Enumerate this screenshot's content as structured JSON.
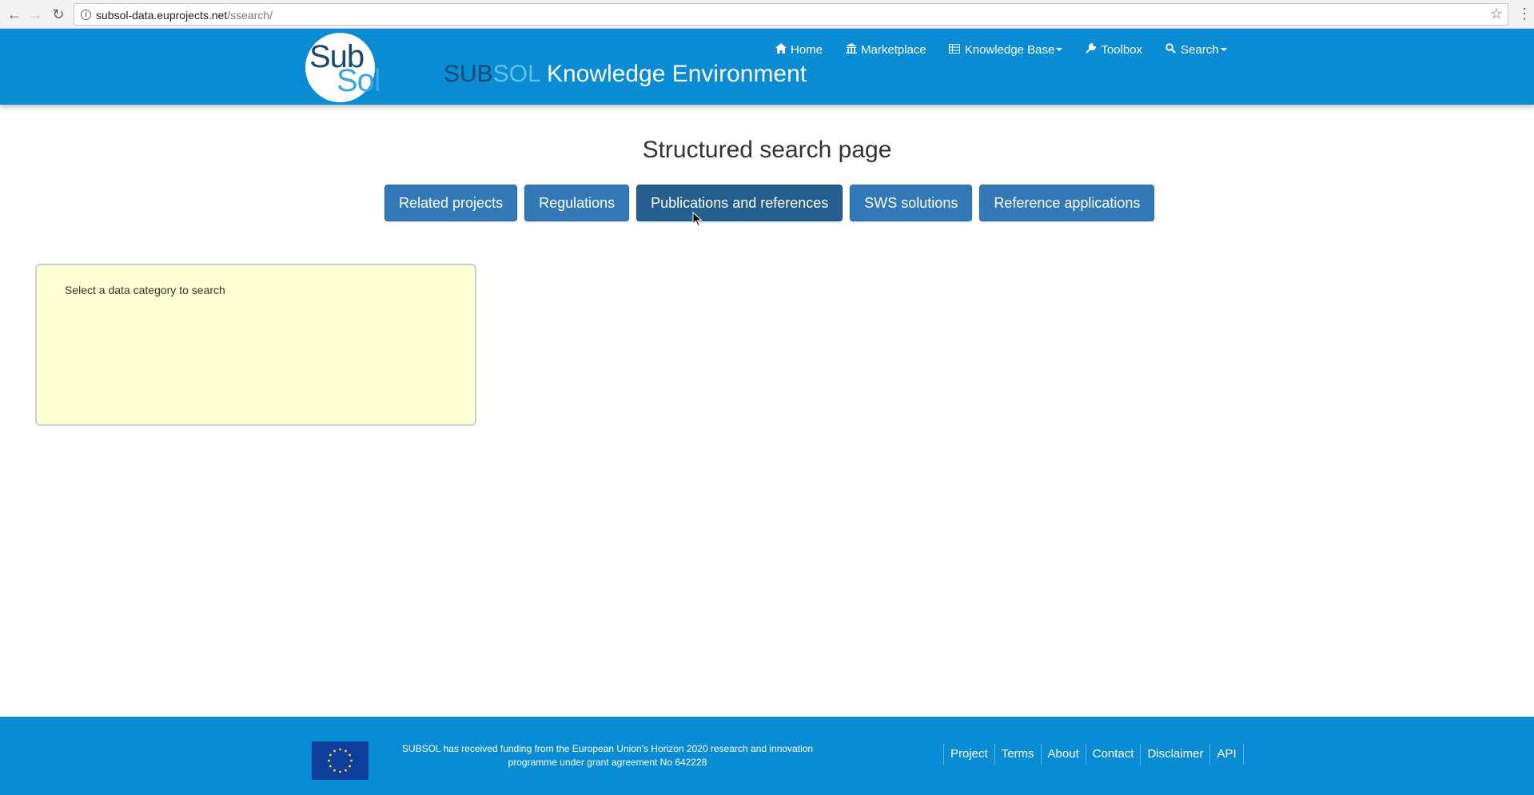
{
  "browser": {
    "url_host": "subsol-data.euprojects.net",
    "url_path": "/ssearch/"
  },
  "header": {
    "logo_sub": "Sub",
    "logo_sol": "Sol",
    "brand_sub": "SUB",
    "brand_sol": "SOL",
    "brand_rest": " Knowledge Environment",
    "nav": [
      {
        "label": "Home",
        "icon": "home-icon"
      },
      {
        "label": "Marketplace",
        "icon": "bank-icon"
      },
      {
        "label": "Knowledge Base",
        "icon": "table-icon"
      },
      {
        "label": "Toolbox",
        "icon": "wrench-icon"
      },
      {
        "label": "Search",
        "icon": "search-icon"
      }
    ]
  },
  "main": {
    "title": "Structured search page",
    "categories": [
      "Related projects",
      "Regulations",
      "Publications and references",
      "SWS solutions",
      "Reference applications"
    ],
    "info_text": "Select a data category to search"
  },
  "footer": {
    "funding_text": "SUBSOL has received funding from the European Union's Horizon 2020 research and innovation programme under grant agreement No 642228",
    "links": [
      "Project",
      "Terms",
      "About",
      "Contact",
      "Disclaimer",
      "API"
    ]
  },
  "colors": {
    "brand_blue": "#0a8cd4",
    "button_blue": "#3379b7",
    "button_active": "#245f8f",
    "info_bg": "#ffffd4"
  }
}
